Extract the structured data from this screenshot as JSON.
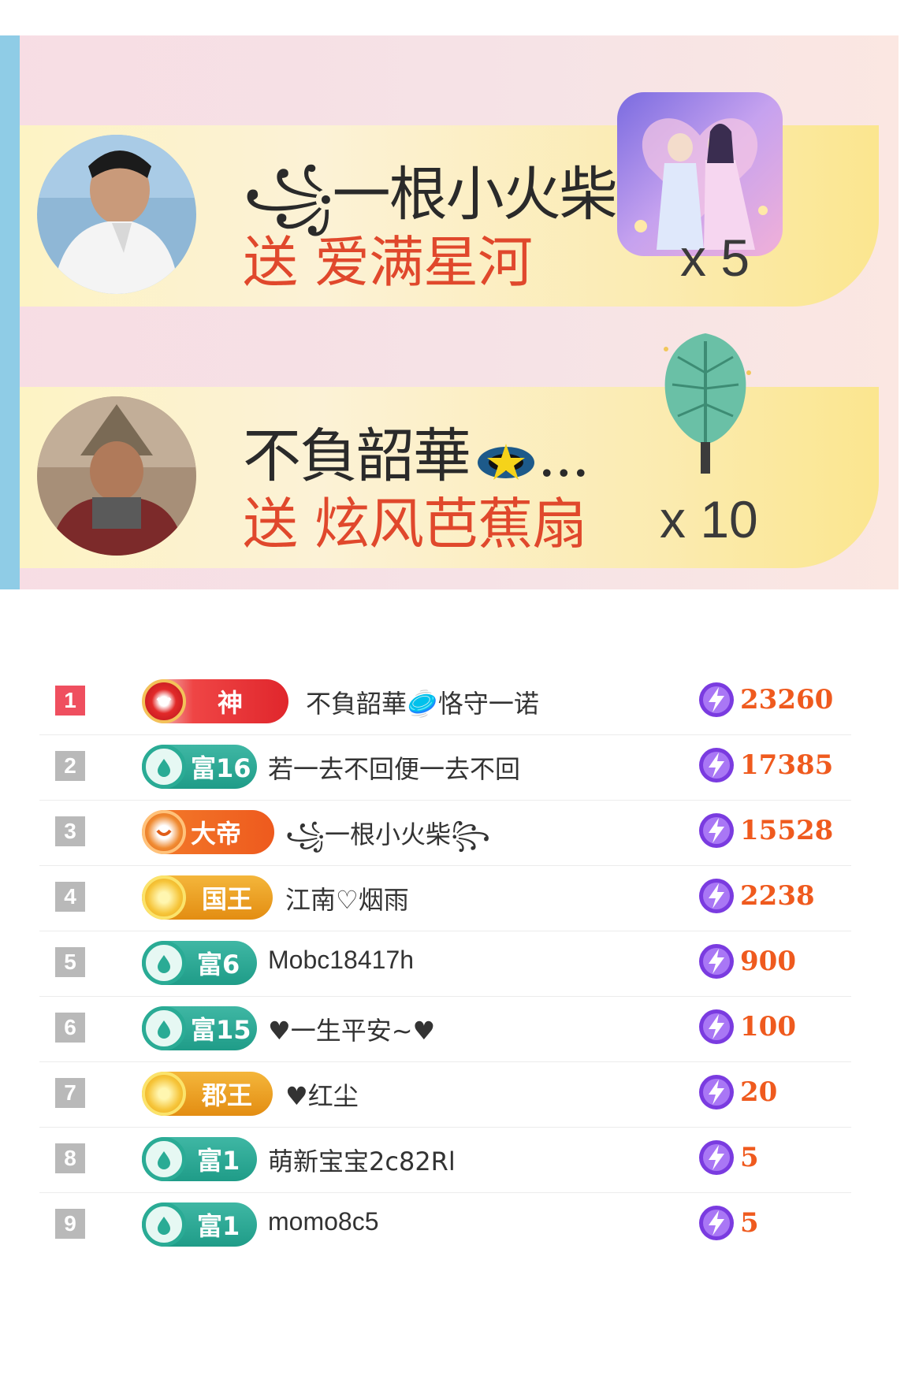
{
  "gifts": [
    {
      "sender": "꧁一根小火柴꧂",
      "verb": "送",
      "gift_name": "爱满星河",
      "count": "x 5",
      "avatar": "avatar-man-white-shirt",
      "gift_icon": "couple-art-gift-icon"
    },
    {
      "sender": "不負韶華",
      "sender_suffix": "...",
      "verb": "送",
      "gift_name": "炫风芭蕉扇",
      "count": "x 10",
      "avatar": "avatar-warrior-helmet",
      "gift_icon": "banana-fan-gift-icon"
    }
  ],
  "ranking": [
    {
      "rank": "1",
      "badge": "神",
      "badge_style": "red",
      "name": "不負韶華🥏恪守一诺",
      "score": "23260"
    },
    {
      "rank": "2",
      "badge": "富16",
      "badge_style": "green",
      "name": "若一去不回便一去不回",
      "score": "17385"
    },
    {
      "rank": "3",
      "badge": "大帝",
      "badge_style": "orange",
      "name": "꧁一根小火柴꧂",
      "score": "15528"
    },
    {
      "rank": "4",
      "badge": "国王",
      "badge_style": "gold",
      "name": "江南♡烟雨",
      "score": "2238"
    },
    {
      "rank": "5",
      "badge": "富6",
      "badge_style": "green",
      "name": "Mobc18417h",
      "score": "900"
    },
    {
      "rank": "6",
      "badge": "富15",
      "badge_style": "green",
      "name": "♥一生平安~♥",
      "score": "100"
    },
    {
      "rank": "7",
      "badge": "郡王",
      "badge_style": "gold",
      "name": "♥红尘",
      "score": "20"
    },
    {
      "rank": "8",
      "badge": "富1",
      "badge_style": "green",
      "name": "萌新宝宝2c82Rl",
      "score": "5"
    },
    {
      "rank": "9",
      "badge": "富1",
      "badge_style": "green",
      "name": "momo8c5",
      "score": "5"
    }
  ],
  "colors": {
    "score": "#ef5a1e",
    "gift_name": "#e0482c",
    "rank_first": "#ef4f5f",
    "stripe": "#8fcce6"
  },
  "icons": {
    "score": "lightning-coin-icon"
  }
}
